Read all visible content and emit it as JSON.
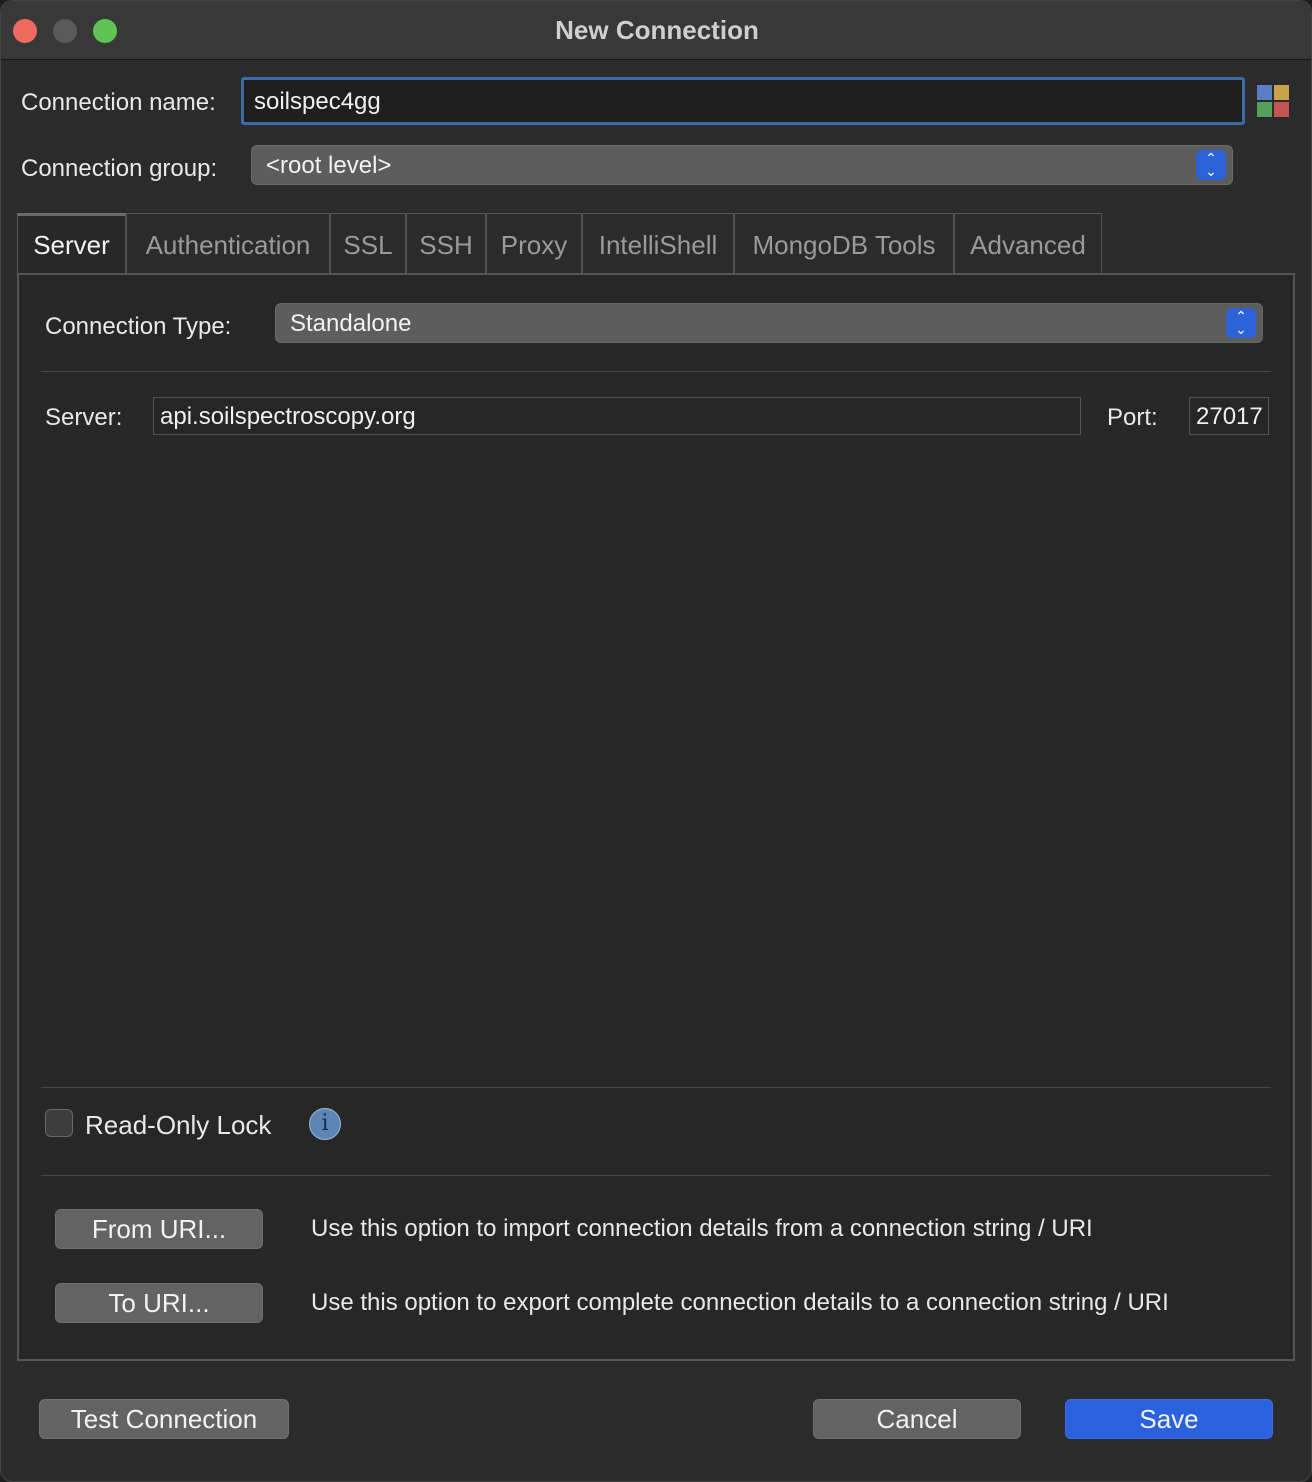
{
  "window": {
    "title": "New Connection"
  },
  "header": {
    "connection_name_label": "Connection name:",
    "connection_name_value": "soilspec4gg",
    "connection_group_label": "Connection group:",
    "connection_group_value": "<root level>"
  },
  "tabs": [
    {
      "label": "Server",
      "active": true
    },
    {
      "label": "Authentication",
      "active": false
    },
    {
      "label": "SSL",
      "active": false
    },
    {
      "label": "SSH",
      "active": false
    },
    {
      "label": "Proxy",
      "active": false
    },
    {
      "label": "IntelliShell",
      "active": false
    },
    {
      "label": "MongoDB Tools",
      "active": false
    },
    {
      "label": "Advanced",
      "active": false
    }
  ],
  "server_tab": {
    "connection_type_label": "Connection Type:",
    "connection_type_value": "Standalone",
    "server_label": "Server:",
    "server_value": "api.soilspectroscopy.org",
    "port_label": "Port:",
    "port_value": "27017",
    "read_only_label": "Read-Only Lock",
    "read_only_checked": false,
    "info_glyph": "i",
    "from_uri_label": "From URI...",
    "from_uri_desc": "Use this option to import connection details from a connection string / URI",
    "to_uri_label": "To URI...",
    "to_uri_desc": "Use this option to export complete connection details to a connection string / URI"
  },
  "footer": {
    "test_label": "Test Connection",
    "cancel_label": "Cancel",
    "save_label": "Save"
  },
  "colors": {
    "accent": "#2b61dc",
    "focus_ring": "#3a6aa8",
    "close": "#ed6a5e",
    "maximize": "#5fc453"
  }
}
